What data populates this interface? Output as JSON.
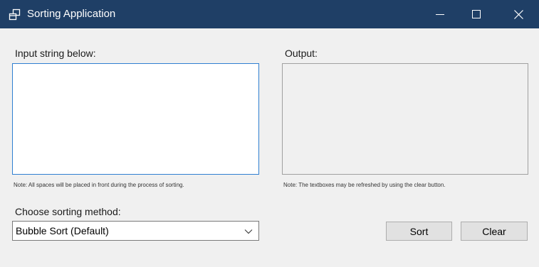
{
  "window": {
    "title": "Sorting Application",
    "titlebar_color": "#1f3f66",
    "icons": {
      "app": "app-window-icon",
      "minimize": "minimize-icon",
      "maximize": "maximize-icon",
      "close": "close-icon"
    }
  },
  "input": {
    "label": "Input string below:",
    "value": "",
    "note": "Note: All spaces will be placed in front during the process of sorting."
  },
  "output": {
    "label": "Output:",
    "value": "",
    "note": "Note: The textboxes may be refreshed by using the clear button."
  },
  "method": {
    "label": "Choose sorting method:",
    "selected": "Bubble Sort (Default)"
  },
  "buttons": {
    "sort": "Sort",
    "clear": "Clear"
  }
}
